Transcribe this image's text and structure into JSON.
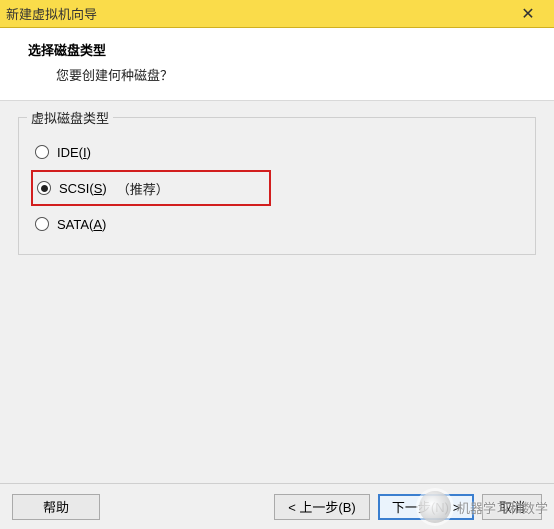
{
  "titlebar": {
    "title": "新建虚拟机向导"
  },
  "header": {
    "title": "选择磁盘类型",
    "subtitle": "您要创建何种磁盘？"
  },
  "group": {
    "title": "虚拟磁盘类型",
    "options": [
      {
        "label": "IDE",
        "hotkey": "I",
        "suffix": "",
        "selected": false
      },
      {
        "label": "SCSI",
        "hotkey": "S",
        "suffix": "（推荐）",
        "selected": true
      },
      {
        "label": "SATA",
        "hotkey": "A",
        "suffix": "",
        "selected": false
      }
    ]
  },
  "footer": {
    "help": "帮助",
    "back": "< 上一步(B)",
    "next": "下一步(N) >",
    "cancel": "取消"
  },
  "watermark": {
    "text": "机器学习和数学"
  }
}
